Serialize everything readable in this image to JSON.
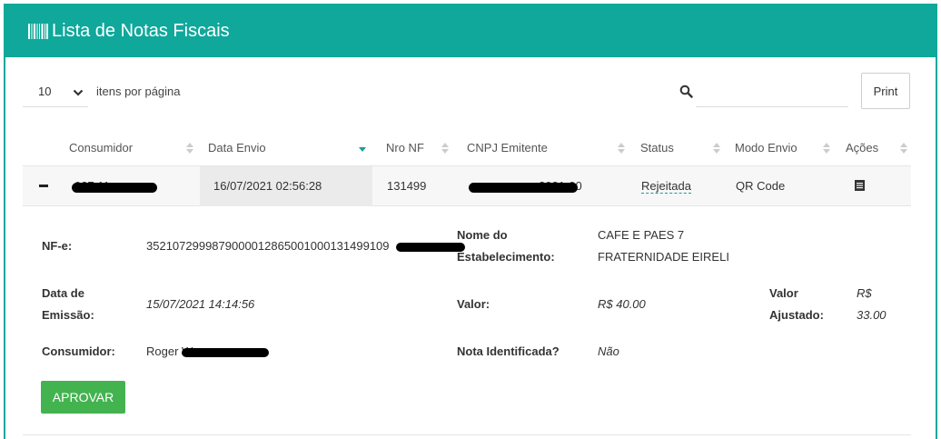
{
  "header": {
    "title": "Lista de Notas Fiscais",
    "icon": "barcode-icon"
  },
  "toolbar": {
    "page_length": "10",
    "page_length_label": "itens por página",
    "search_placeholder": "",
    "print_label": "Print"
  },
  "table": {
    "columns": [
      {
        "label": "Consumidor",
        "sort": "none"
      },
      {
        "label": "Data Envio",
        "sort": "desc"
      },
      {
        "label": "Nro NF",
        "sort": "none"
      },
      {
        "label": "CNPJ Emitente",
        "sort": "none"
      },
      {
        "label": "Status",
        "sort": "none"
      },
      {
        "label": "Modo Envio",
        "sort": "none"
      },
      {
        "label": "Ações",
        "sort": "none"
      }
    ],
    "rows": [
      {
        "consumidor": "027.11",
        "data_envio": "16/07/2021 02:56:28",
        "nro_nf": "131499",
        "cnpj": "2021-00",
        "status": "Rejeitada",
        "modo_envio": "QR Code"
      }
    ]
  },
  "detail": {
    "nfe_label": "NF-e:",
    "nfe_value": "3521072999879000012865001000131499109",
    "nome_label_1": "Nome do",
    "nome_label_2": "Estabelecimento:",
    "nome_value_1": "CAFE E PAES 7",
    "nome_value_2": "FRATERNIDADE EIRELI",
    "emissao_label_1": "Data de",
    "emissao_label_2": "Emissão:",
    "emissao_value": "15/07/2021 14:14:56",
    "valor_label": "Valor:",
    "valor_value": "R$ 40.00",
    "ajustado_label_1": "Valor",
    "ajustado_label_2": "Ajustado:",
    "ajustado_value_1": "R$",
    "ajustado_value_2": "33.00",
    "consumidor_label": "Consumidor:",
    "consumidor_value": "Roger W",
    "identificada_label": "Nota Identificada?",
    "identificada_value": "Não",
    "approve_label": "APROVAR"
  },
  "colors": {
    "brand": "#0fa89b",
    "link": "#1a9e95",
    "approve": "#43b34f"
  }
}
